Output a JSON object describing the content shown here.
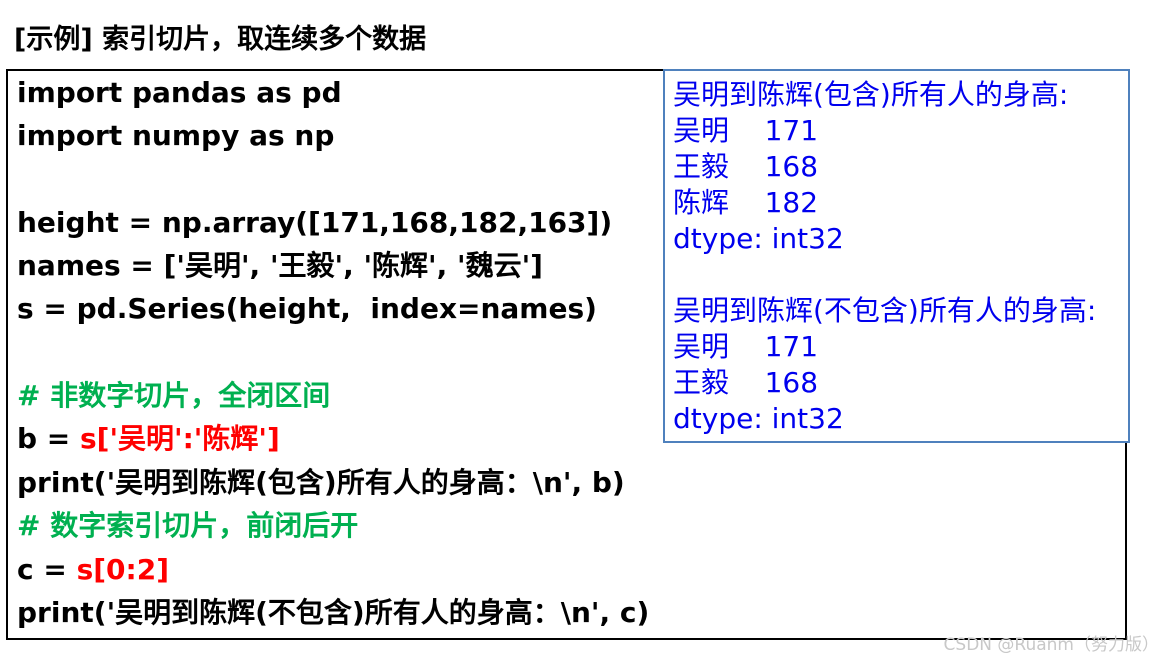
{
  "title": "[示例] 索引切片，取连续多个数据",
  "code": {
    "line1": "import pandas as pd",
    "line2": "import numpy as np",
    "line4": "height = np.array([171,168,182,163])",
    "line5": "names = ['吴明', '王毅', '陈辉', '魏云']",
    "line6": "s = pd.Series(height,  index=names)",
    "comment1": "# 非数字切片，全闭区间",
    "line9_prefix": "b = ",
    "line9_expr": "s['吴明':'陈辉']",
    "line10": "print('吴明到陈辉(包含)所有人的身高：\\n', b)",
    "comment2": "# 数字索引切片，前闭后开",
    "line12_prefix": "c = ",
    "line12_expr": "s[0:2]",
    "line13": "print('吴明到陈辉(不包含)所有人的身高：\\n', c)"
  },
  "output": {
    "block1": {
      "header": "吴明到陈辉(包含)所有人的身高:",
      "rows": [
        "吴明    171",
        "王毅    168",
        "陈辉    182"
      ],
      "dtype": "dtype: int32"
    },
    "block2": {
      "header": "吴明到陈辉(不包含)所有人的身高:",
      "rows": [
        "吴明    171",
        "王毅    168"
      ],
      "dtype": "dtype: int32"
    }
  },
  "watermark": "CSDN @Ruanm（努力版）",
  "colors": {
    "comment": "#00b050",
    "highlight": "#ff0000",
    "output_text": "#0000ee",
    "output_border": "#4f81bd"
  }
}
